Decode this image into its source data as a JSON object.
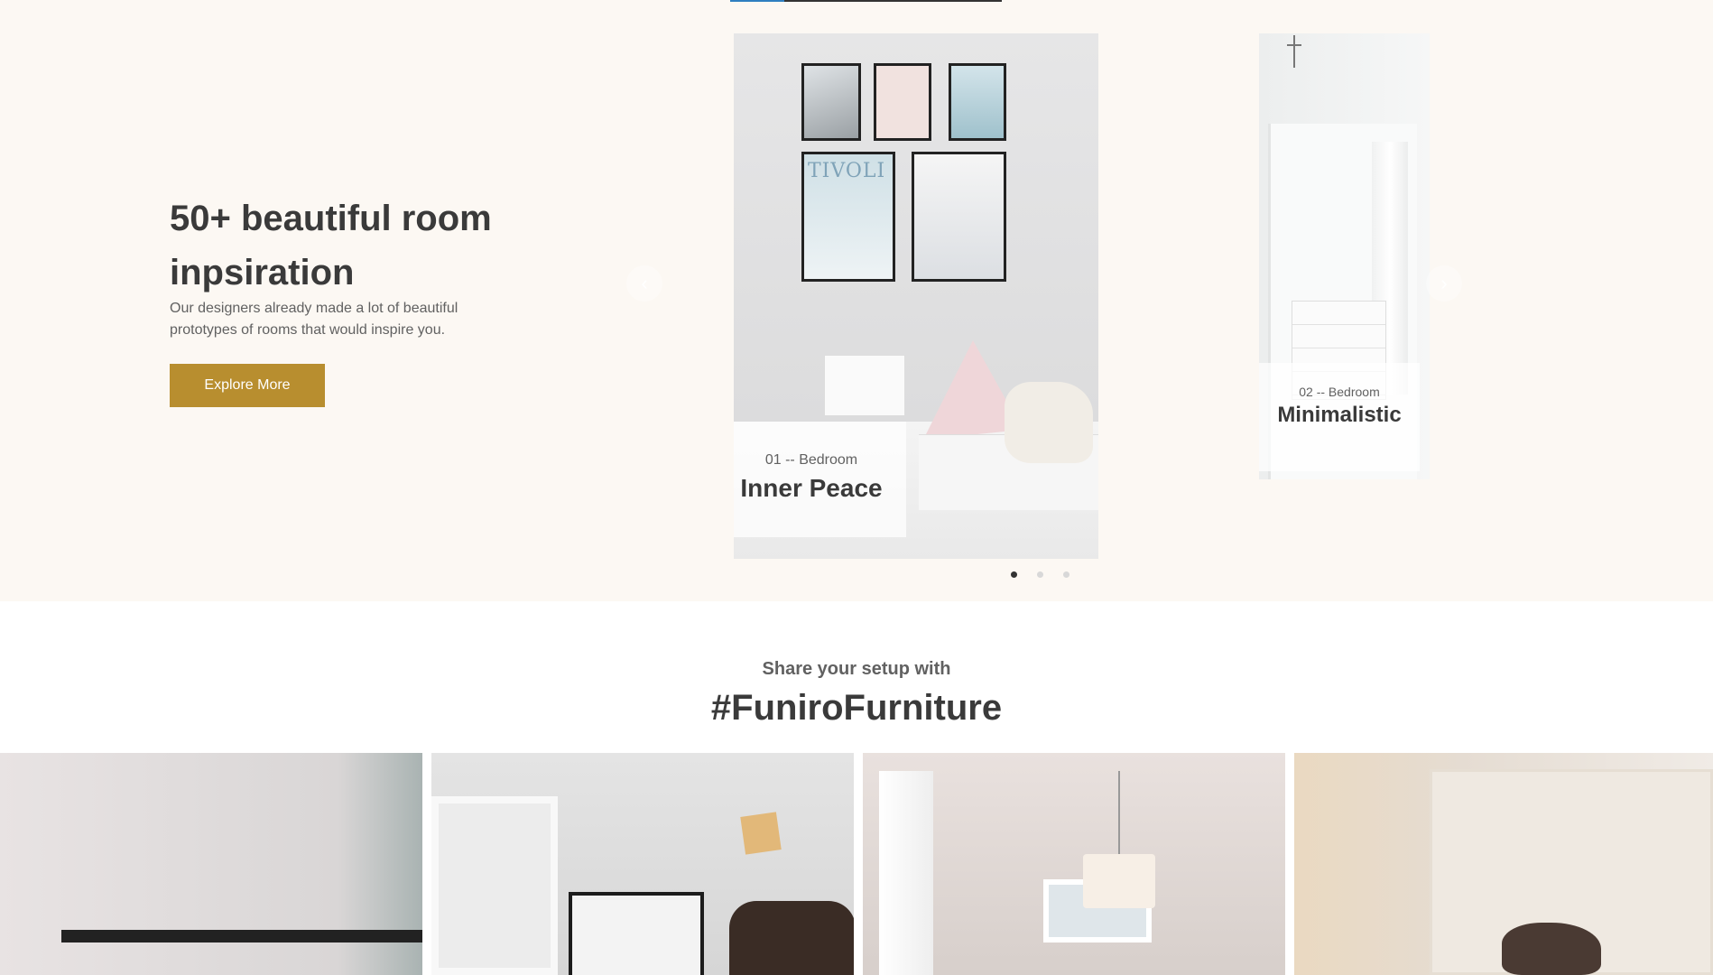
{
  "hero": {
    "title": "50+ beautiful room inpsiration",
    "description": "Our designers already made a lot of beautiful prototypes of rooms that would inspire you.",
    "button_label": "Explore More"
  },
  "slider": {
    "prev_icon": "chevron-left-icon",
    "next_icon": "chevron-right-icon",
    "prev_glyph": "‹",
    "next_glyph": "›",
    "slides": [
      {
        "subtitle": "01 -- Bedroom",
        "title": "Inner Peace"
      },
      {
        "subtitle": "02 -- Bedroom",
        "title": "Minimalistic"
      }
    ],
    "dots": 3,
    "active_dot": 0,
    "poster_text": "TIVOLI"
  },
  "share": {
    "subtitle": "Share your setup with",
    "title": "#FuniroFurniture"
  },
  "colors": {
    "accent": "#b88e2f",
    "hero_background": "#fcf8f3",
    "progress_fill": "#2f7fc0"
  }
}
